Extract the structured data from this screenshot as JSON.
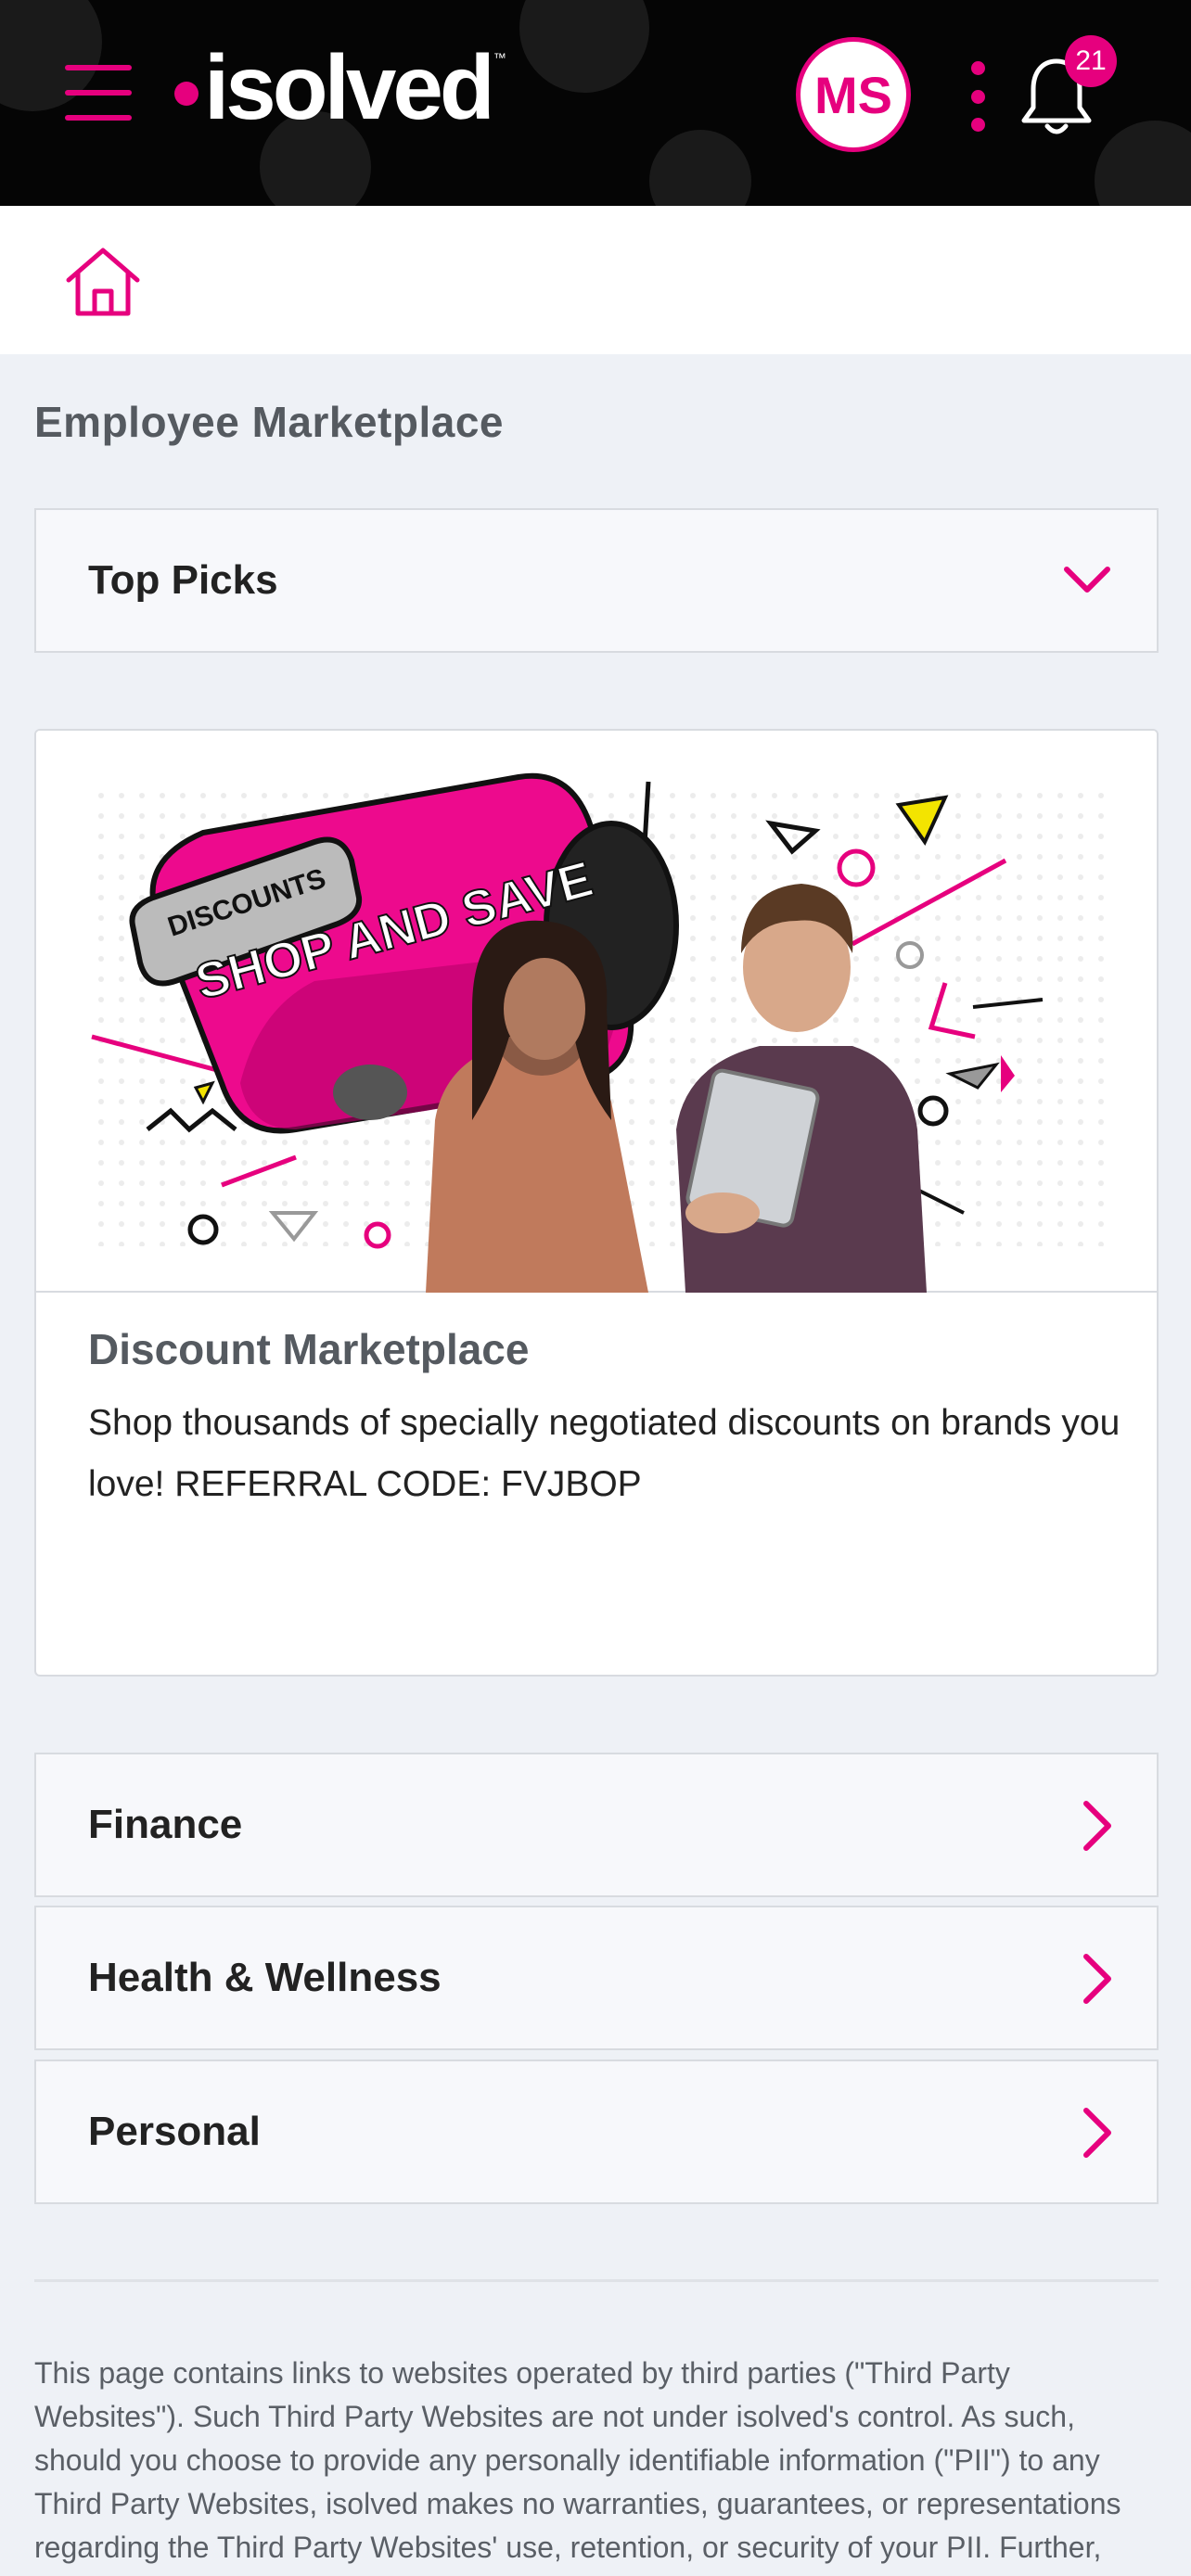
{
  "header": {
    "logo_text": "isolved",
    "logo_tm": "™",
    "avatar_initials": "MS",
    "notification_count": "21",
    "brand_color": "#e6007e",
    "icons": [
      "menu-icon",
      "kebab-icon",
      "bell-icon",
      "home-icon"
    ]
  },
  "page": {
    "title": "Employee Marketplace"
  },
  "dropdown": {
    "selected": "Top Picks"
  },
  "card": {
    "banner": {
      "tag": "DISCOUNTS",
      "headline": "SHOP AND SAVE"
    },
    "title": "Discount Marketplace",
    "description": "Shop thousands of specially negotiated discounts on brands you love! REFERRAL CODE: FVJBOP"
  },
  "categories": [
    {
      "label": "Finance"
    },
    {
      "label": "Health & Wellness"
    },
    {
      "label": "Personal"
    }
  ],
  "disclaimer": "This page contains links to websites operated by third parties (\"Third Party Websites\"). Such Third Party Websites are not under isolved's control. As such, should you choose to provide any personally identifiable information (\"PII\") to any Third Party Websites, isolved makes no warranties, guarantees, or representations regarding the Third Party Websites' use, retention, or security of your PII. Further,"
}
